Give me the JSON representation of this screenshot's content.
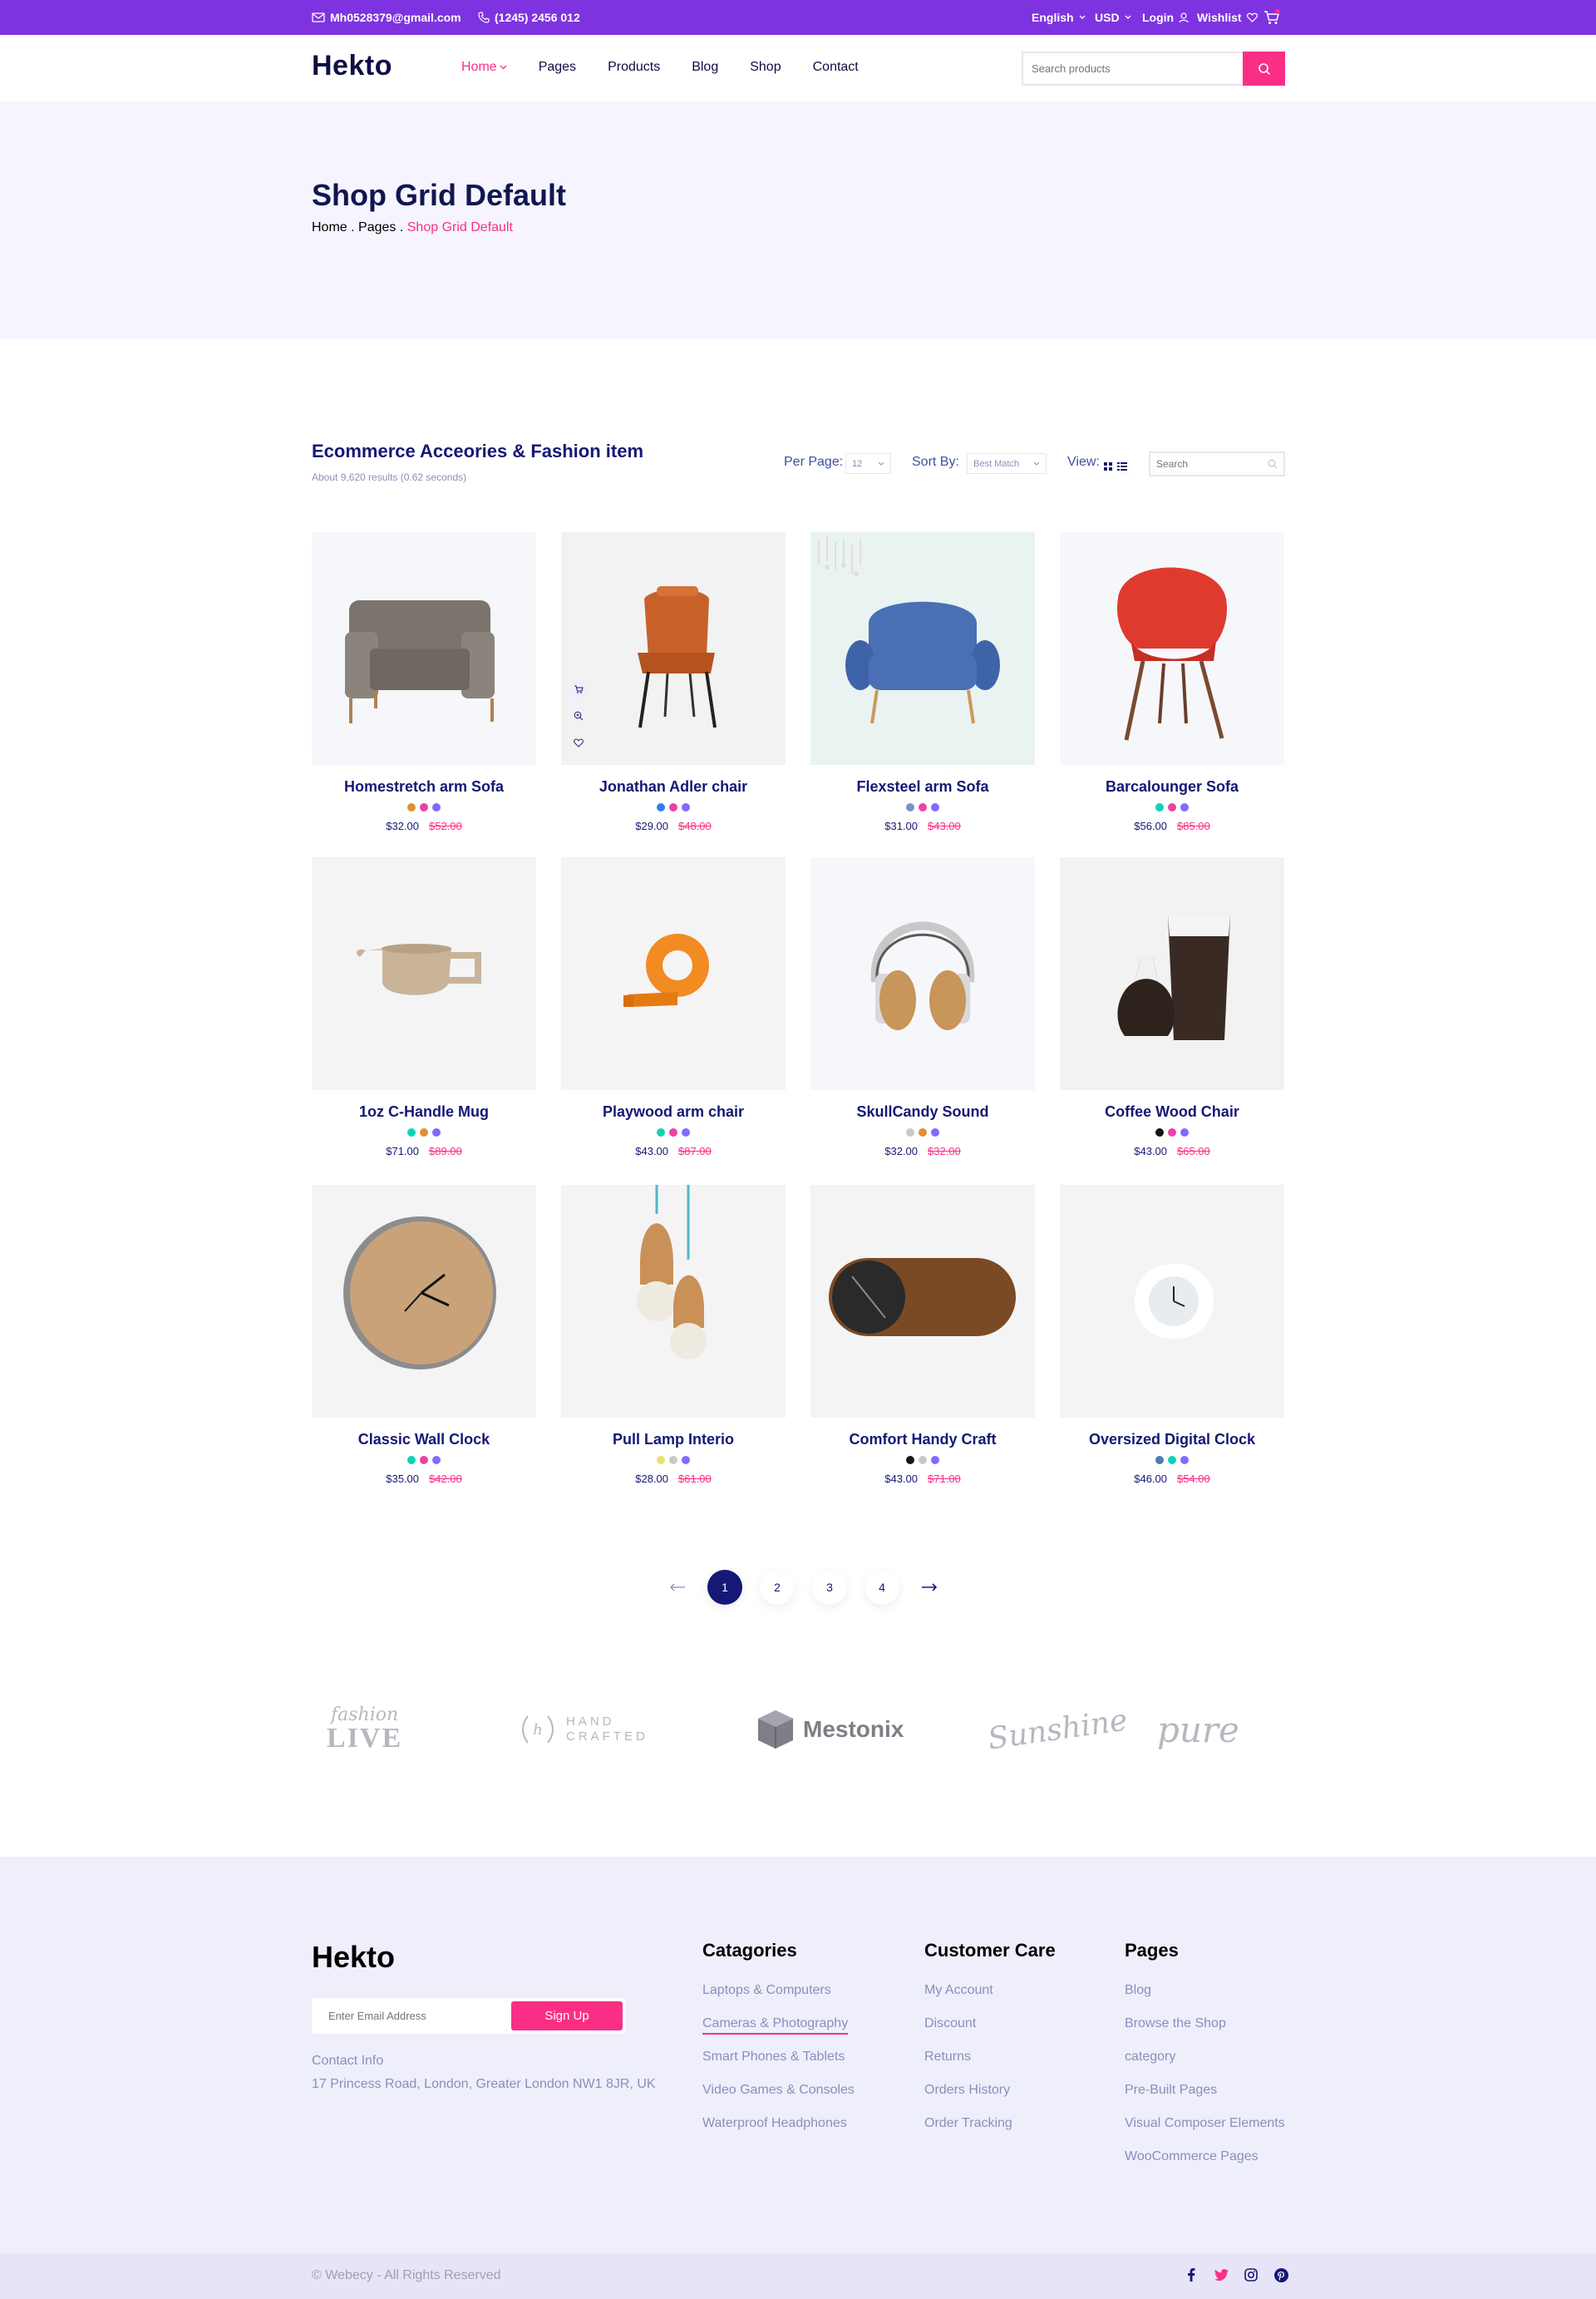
{
  "topbar": {
    "email": "Mh0528379@gmail.com",
    "phone": "(1245) 2456 012",
    "language": "English",
    "currency": "USD",
    "login": "Login",
    "wishlist": "Wishlist"
  },
  "header": {
    "logo": "Hekto",
    "nav": [
      "Home",
      "Pages",
      "Products",
      "Blog",
      "Shop",
      "Contact"
    ],
    "search_placeholder": "Search products"
  },
  "hero": {
    "title": "Shop Grid Default",
    "breadcrumb": [
      "Home",
      "Pages",
      "Shop Grid Default"
    ]
  },
  "toolbar": {
    "title": "Ecommerce Acceories & Fashion item",
    "subtitle": "About 9,620 results (0.62 seconds)",
    "per_page_label": "Per Page:",
    "per_page_value": "12",
    "sort_label": "Sort By:",
    "sort_value": "Best Match",
    "view_label": "View:",
    "search_placeholder": "Search"
  },
  "products": [
    {
      "name": "Homestretch arm Sofa",
      "price": "$32.00",
      "old_price": "$52.00",
      "colors": [
        "#DE9034",
        "#EC42A2",
        "#8568FF"
      ]
    },
    {
      "name": "Jonathan Adler chair",
      "price": "$29.00",
      "old_price": "$48.00",
      "colors": [
        "#2F80ED",
        "#EC42A2",
        "#8568FF"
      ]
    },
    {
      "name": "Flexsteel arm Sofa",
      "price": "$31.00",
      "old_price": "$43.00",
      "colors": [
        "#7B92C8",
        "#EC42A2",
        "#8568FF"
      ]
    },
    {
      "name": "Barcalounger Sofa",
      "price": "$56.00",
      "old_price": "$85.00",
      "colors": [
        "#0FD3B6",
        "#EC42A2",
        "#8568FF"
      ]
    },
    {
      "name": "1oz C-Handle Mug",
      "price": "$71.00",
      "old_price": "$89.00",
      "colors": [
        "#0FD3B6",
        "#DE9034",
        "#8568FF"
      ]
    },
    {
      "name": "Playwood arm chair",
      "price": "$43.00",
      "old_price": "$87.00",
      "colors": [
        "#0FD3B6",
        "#EC42A2",
        "#8568FF"
      ]
    },
    {
      "name": "SkullCandy Sound",
      "price": "$32.00",
      "old_price": "$32.00",
      "colors": [
        "#C9C9C9",
        "#DE9034",
        "#8568FF"
      ]
    },
    {
      "name": "Coffee Wood Chair",
      "price": "$43.00",
      "old_price": "$65.00",
      "colors": [
        "#151515",
        "#EC42A2",
        "#8568FF"
      ]
    },
    {
      "name": "Classic Wall Clock",
      "price": "$35.00",
      "old_price": "$42.00",
      "colors": [
        "#0FD3B6",
        "#EC42A2",
        "#8568FF"
      ]
    },
    {
      "name": "Pull Lamp Interio",
      "price": "$28.00",
      "old_price": "$61.00",
      "colors": [
        "#E8E169",
        "#C9C9C9",
        "#8568FF"
      ]
    },
    {
      "name": "Comfort Handy Craft",
      "price": "$43.00",
      "old_price": "$71.00",
      "colors": [
        "#151515",
        "#C9C9C9",
        "#8568FF"
      ]
    },
    {
      "name": "Oversized Digital Clock",
      "price": "$46.00",
      "old_price": "$54.00",
      "colors": [
        "#4E7BB5",
        "#0FD3B6",
        "#8568FF"
      ]
    }
  ],
  "pagination": {
    "pages": [
      "1",
      "2",
      "3",
      "4"
    ],
    "current": "1"
  },
  "brands": {
    "fashion_top": "fashion",
    "fashion_bottom": "LIVE",
    "handcrafted_top": "HAND",
    "handcrafted_bottom": "CRAFTED",
    "mestonix": "Mestonix",
    "sunshine": "Sunshine",
    "pure": "pure"
  },
  "footer": {
    "logo": "Hekto",
    "email_placeholder": "Enter Email Address",
    "signup": "Sign Up",
    "contact_label": "Contact Info",
    "address": "17 Princess Road, London, Greater London NW1 8JR, UK",
    "columns": [
      {
        "title": "Catagories",
        "links": [
          "Laptops & Computers",
          "Cameras & Photography",
          "Smart Phones & Tablets",
          "Video Games & Consoles",
          "Waterproof Headphones"
        ]
      },
      {
        "title": "Customer Care",
        "links": [
          "My Account",
          "Discount",
          "Returns",
          "Orders History",
          "Order Tracking"
        ]
      },
      {
        "title": "Pages",
        "links": [
          "Blog",
          "Browse the Shop",
          "category",
          "Pre-Built Pages",
          "Visual Composer Elements",
          "WooCommerce Pages"
        ]
      }
    ],
    "copyright": "© Webecy - All Rights Reserved"
  },
  "colors": {
    "accent": "#FB2E86",
    "brand": "#7E33E0",
    "navy": "#151875"
  },
  "icons": [
    "mail-icon",
    "phone-icon",
    "user-icon",
    "heart-icon",
    "cart-icon",
    "search-icon",
    "grid-view-icon",
    "list-view-icon",
    "facebook-icon",
    "twitter-icon",
    "instagram-icon",
    "pinterest-icon"
  ]
}
